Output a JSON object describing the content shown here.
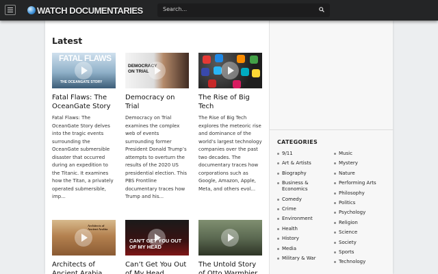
{
  "header": {
    "logo_text": "WATCH DOCUMENTARIES",
    "search_placeholder": "Search..."
  },
  "main": {
    "section_title": "Latest",
    "cards": [
      {
        "title": "Fatal Flaws: The OceanGate Story",
        "thumb_text": "FATAL FLAWS",
        "thumb_subtext": "THE OCEANGATE STORY",
        "description": "Fatal Flaws: The OceanGate Story delves into the tragic events surrounding the OceanGate submersible disaster that occurred during an expedition to the Titanic. It examines how the Titan, a privately operated submersible, imp..."
      },
      {
        "title": "Democracy on Trial",
        "thumb_text": "DEMOCRACY ON TRIAL",
        "description": "Democracy on Trial examines the complex web of events surrounding former President Donald Trump’s attempts to overturn the results of the 2020 US presidential election. This PBS Frontline documentary traces how Trump and his..."
      },
      {
        "title": "The Rise of Big Tech",
        "description": "The Rise of Big Tech explores the meteoric rise and dominance of the world’s largest technology companies over the past two decades. The documentary traces how corporations such as Google, Amazon, Apple, Meta, and others evol..."
      },
      {
        "title": "Architects of Ancient Arabia",
        "thumb_text": "Architects of Ancient Arabia"
      },
      {
        "title": "Can’t Get You Out of My Head",
        "thumb_text": "CAN'T GET YOU OUT OF MY HEAD"
      },
      {
        "title": "The Untold Story of Otto Warmbier"
      }
    ]
  },
  "sidebar": {
    "categories_title": "CATEGORIES",
    "col1": [
      "9/11",
      "Art & Artists",
      "Biography",
      "Business & Economics",
      "Comedy",
      "Crime",
      "Environment",
      "Health",
      "History",
      "Media",
      "Military & War"
    ],
    "col2": [
      "Music",
      "Mystery",
      "Nature",
      "Performing Arts",
      "Philosophy",
      "Politics",
      "Psychology",
      "Religion",
      "Science",
      "Society",
      "Sports",
      "Technology"
    ]
  },
  "colors": {
    "topbar": "#242526",
    "panel": "#ffffff",
    "sidebar": "#f7f7f7",
    "page_bg": "#eceef0"
  }
}
